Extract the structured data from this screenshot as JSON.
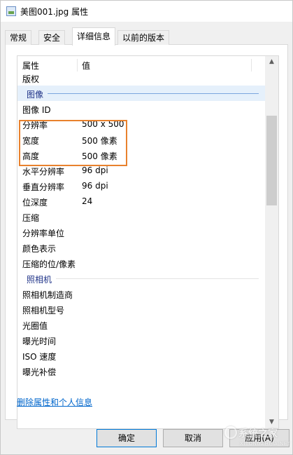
{
  "window": {
    "title": "美图001.jpg 属性"
  },
  "tabs": [
    {
      "label": "常规"
    },
    {
      "label": "安全"
    },
    {
      "label": "详细信息"
    },
    {
      "label": "以前的版本"
    }
  ],
  "details": {
    "header": {
      "property": "属性",
      "value": "值"
    },
    "rows_top": [
      {
        "name": "版权",
        "value": ""
      }
    ],
    "group_image": "图像",
    "rows_image": [
      {
        "name": "图像 ID",
        "value": ""
      },
      {
        "name": "分辨率",
        "value": "500 x 500"
      },
      {
        "name": "宽度",
        "value": "500 像素"
      },
      {
        "name": "高度",
        "value": "500 像素"
      },
      {
        "name": "水平分辨率",
        "value": "96 dpi"
      },
      {
        "name": "垂直分辨率",
        "value": "96 dpi"
      },
      {
        "name": "位深度",
        "value": "24"
      },
      {
        "name": "压缩",
        "value": ""
      },
      {
        "name": "分辨率单位",
        "value": ""
      },
      {
        "name": "颜色表示",
        "value": ""
      },
      {
        "name": "压缩的位/像素",
        "value": ""
      }
    ],
    "group_camera": "照相机",
    "rows_camera": [
      {
        "name": "照相机制造商",
        "value": ""
      },
      {
        "name": "照相机型号",
        "value": ""
      },
      {
        "name": "光圈值",
        "value": ""
      },
      {
        "name": "曝光时间",
        "value": ""
      },
      {
        "name": "ISO 速度",
        "value": ""
      },
      {
        "name": "曝光补偿",
        "value": ""
      }
    ]
  },
  "link": {
    "remove_props": "删除属性和个人信息"
  },
  "buttons": {
    "ok": "确定",
    "cancel": "取消",
    "apply": "应用(A)"
  },
  "watermark": {
    "text": "系统之家",
    "sub": "XITONGZHIJIA.NET"
  },
  "colors": {
    "highlight": "#e8812d",
    "link": "#0066cc",
    "group": "#1e3287"
  }
}
